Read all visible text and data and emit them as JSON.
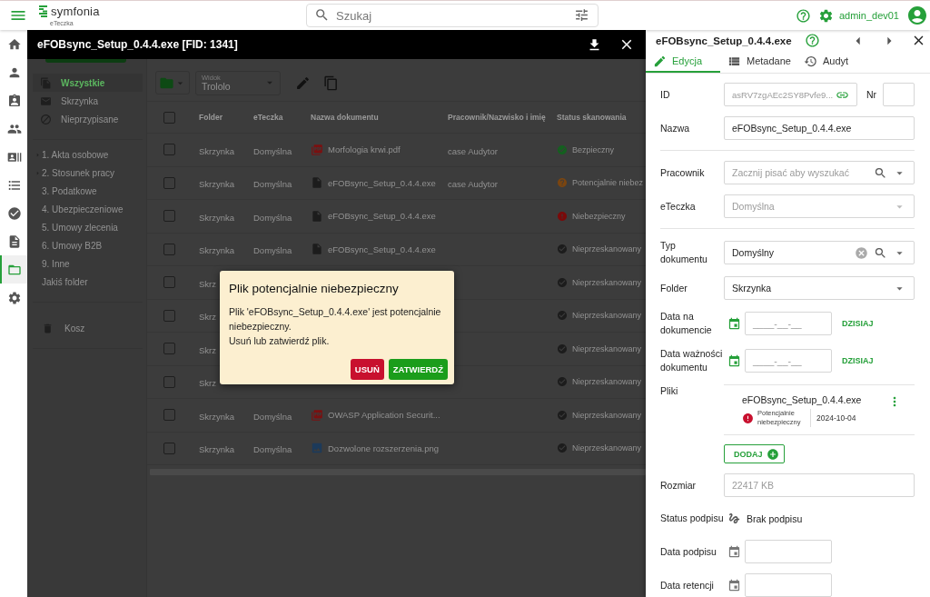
{
  "header": {
    "logo": "symfonia",
    "product": "eTeczka",
    "search": {
      "placeholder": "Szukaj"
    },
    "user": "admin_dev01"
  },
  "rail": [
    {
      "selected": false
    },
    {
      "selected": false
    },
    {
      "selected": false
    },
    {
      "selected": false
    },
    {
      "selected": false
    },
    {
      "selected": false
    },
    {
      "selected": false
    },
    {
      "selected": false
    },
    {
      "selected": true
    },
    {
      "selected": false
    }
  ],
  "viewer": {
    "title": "eFOBsync_Setup_0.4.4.exe [FID: 1341]"
  },
  "nav": {
    "views": [
      {
        "label": "Wszystkie",
        "selected": true
      },
      {
        "label": "Skrzynka",
        "selected": false
      },
      {
        "label": "Nieprzypisane",
        "selected": false
      }
    ],
    "folders": [
      {
        "label": "1. Akta osobowe",
        "kind": "branch"
      },
      {
        "label": "2. Stosunek pracy",
        "kind": "branch"
      },
      {
        "label": "3. Podatkowe",
        "kind": "leaf"
      },
      {
        "label": "4. Ubezpieczeniowe",
        "kind": "leaf"
      },
      {
        "label": "5. Umowy zlecenia",
        "kind": "leaf"
      },
      {
        "label": "6. Umowy B2B",
        "kind": "leaf"
      },
      {
        "label": "9. Inne",
        "kind": "leaf"
      },
      {
        "label": "Jakiś folder",
        "kind": "leaf"
      }
    ],
    "trash": "Kosz"
  },
  "toolbar": {
    "view_label": "Widok",
    "view_value": "Trololo"
  },
  "table": {
    "select_all": {
      "checked": false
    },
    "columns": [
      "Folder",
      "eTeczka",
      "Nazwa dokumentu",
      "Pracownik/Nazwisko i imię",
      "Status skanowania"
    ],
    "rows": [
      {
        "checked": false,
        "folder": "Skrzynka",
        "eteczka": "Domyślna",
        "document": {
          "name": "Morfologia krwi.pdf",
          "kind": "pdf"
        },
        "employee": "case Audytor",
        "scan": {
          "text": "Bezpieczny",
          "kind": "safe"
        }
      },
      {
        "checked": false,
        "folder": "Skrzynka",
        "eteczka": "Domyślna",
        "document": {
          "name": "eFOBsync_Setup_0.4.4.exe",
          "kind": "file"
        },
        "employee": "case Audytor",
        "scan": {
          "text": "Potencjalnie niebez",
          "kind": "warning"
        }
      },
      {
        "checked": false,
        "folder": "Skrzynka",
        "eteczka": "Domyślna",
        "document": {
          "name": "eFOBsync_Setup_0.4.4.exe",
          "kind": "file"
        },
        "scan": {
          "text": "Niebezpieczny",
          "kind": "danger"
        }
      },
      {
        "checked": false,
        "folder": "Skrzynka",
        "eteczka": "Domyślna",
        "document": {
          "name": "eFOBsync_Setup_0.4.4.exe",
          "kind": "file"
        },
        "scan": {
          "text": "Nieprzeskanowany",
          "kind": "unscanned"
        }
      },
      {
        "checked": false,
        "folder": "Skrz",
        "scan": {
          "text": "Nieprzeskanowany",
          "kind": "unscanned"
        }
      },
      {
        "checked": false,
        "folder": "Skrz",
        "scan": {
          "text": "Nieprzeskanowany",
          "kind": "unscanned"
        }
      },
      {
        "checked": false,
        "folder": "Skrz",
        "scan": {
          "text": "Nieprzeskanowany",
          "kind": "unscanned"
        }
      },
      {
        "checked": false,
        "folder": "Skrz",
        "scan": {
          "text": "Nieprzeskanowany",
          "kind": "unscanned"
        }
      },
      {
        "checked": false,
        "folder": "Skrzynka",
        "eteczka": "Domyślna",
        "document": {
          "name": "OWASP Application Securit...",
          "kind": "pdf"
        },
        "scan": {
          "text": "Nieprzeskanowany",
          "kind": "unscanned"
        }
      },
      {
        "checked": false,
        "folder": "Skrzynka",
        "eteczka": "Domyślna",
        "document": {
          "name": "Dozwolone rozszerzenia.png",
          "kind": "image"
        },
        "scan": {
          "text": "Nieprzeskanowany",
          "kind": "unscanned"
        }
      }
    ]
  },
  "dialog": {
    "title": "Plik potencjalnie niebezpieczny",
    "lines": [
      "Plik 'eFOBsync_Setup_0.4.4.exe' jest potencjalnie niebezpieczny.",
      "Usuń lub zatwierdź plik."
    ],
    "buttons": [
      {
        "label": "USUŃ",
        "kind": "danger"
      },
      {
        "label": "ZATWIERDŹ",
        "kind": "confirm"
      }
    ]
  },
  "panel": {
    "title": "eFOBsync_Setup_0.4.4.exe",
    "tabs": [
      {
        "label": "Edycja",
        "selected": true
      },
      {
        "label": "Metadane",
        "selected": false
      },
      {
        "label": "Audyt",
        "selected": false
      }
    ],
    "form": [
      {
        "kind": "id",
        "label": "ID",
        "value": "asRV7zgAEc2SY8Pvfe9...",
        "extra_label": "Nr"
      },
      {
        "kind": "text",
        "label": "Nazwa",
        "value": "eFOBsync_Setup_0.4.4.exe",
        "disabled": false
      },
      {
        "kind": "divider"
      },
      {
        "kind": "lookup",
        "label": "Pracownik",
        "placeholder": "Zacznij pisać aby wyszukać",
        "clearable": false
      },
      {
        "kind": "select",
        "label": "eTeczka",
        "value": "Domyślna",
        "disabled": true
      },
      {
        "kind": "divider"
      },
      {
        "kind": "lookup",
        "label": "Typ dokumentu",
        "value": "Domyślny",
        "clearable": true
      },
      {
        "kind": "select",
        "label": "Folder",
        "value": "Skrzynka",
        "disabled": false
      },
      {
        "kind": "date",
        "label": "Data na dokumencie",
        "placeholder": "____-__-__",
        "action": "DZISIAJ",
        "editable": true
      },
      {
        "kind": "date",
        "label": "Data ważności dokumentu",
        "placeholder": "____-__-__",
        "action": "DZISIAJ",
        "editable": true
      },
      {
        "kind": "files",
        "label": "Pliki",
        "files": [
          {
            "name": "eFOBsync_Setup_0.4.4.exe",
            "scan": {
              "text": "Potencjalnie niebezpieczny",
              "kind": "danger"
            },
            "date": "2024-10-04"
          }
        ],
        "add_label": "DODAJ"
      },
      {
        "kind": "text",
        "label": "Rozmiar",
        "value": "22417 KB",
        "disabled": true
      },
      {
        "kind": "signature",
        "label": "Status podpisu",
        "value": "Brak podpisu"
      },
      {
        "kind": "date",
        "label": "Data podpisu",
        "editable": false
      },
      {
        "kind": "date",
        "label": "Data retencji",
        "editable": false
      }
    ]
  }
}
